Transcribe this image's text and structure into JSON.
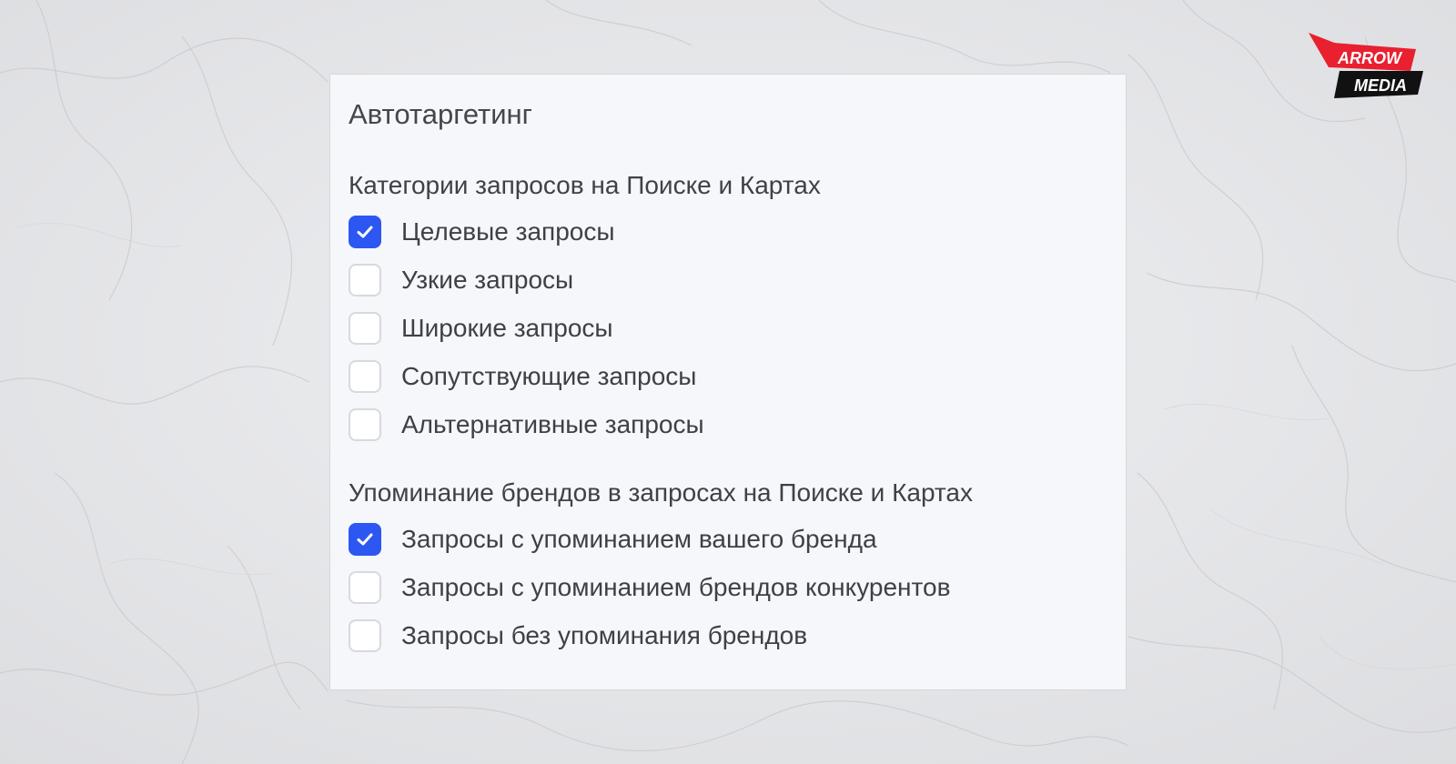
{
  "panel": {
    "title": "Автотаргетинг",
    "sections": [
      {
        "title": "Категории запросов на Поиске и Картах",
        "options": [
          {
            "label": "Целевые запросы",
            "checked": true
          },
          {
            "label": "Узкие запросы",
            "checked": false
          },
          {
            "label": "Широкие запросы",
            "checked": false
          },
          {
            "label": "Сопутствующие запросы",
            "checked": false
          },
          {
            "label": "Альтернативные запросы",
            "checked": false
          }
        ]
      },
      {
        "title": "Упоминание брендов в запросах на Поиске и Картах",
        "options": [
          {
            "label": "Запросы с упоминанием вашего бренда",
            "checked": true
          },
          {
            "label": "Запросы с упоминанием брендов конкурентов",
            "checked": false
          },
          {
            "label": "Запросы без упоминания брендов",
            "checked": false
          }
        ]
      }
    ]
  },
  "logo": {
    "line1": "ARROW",
    "line2": "MEDIA",
    "accent_color": "#e8202f",
    "dark_color": "#111111"
  },
  "colors": {
    "checkbox_checked": "#2d57f2",
    "checkbox_border": "#d7d9df",
    "panel_bg": "#f6f7fb",
    "text": "#3f4047"
  }
}
